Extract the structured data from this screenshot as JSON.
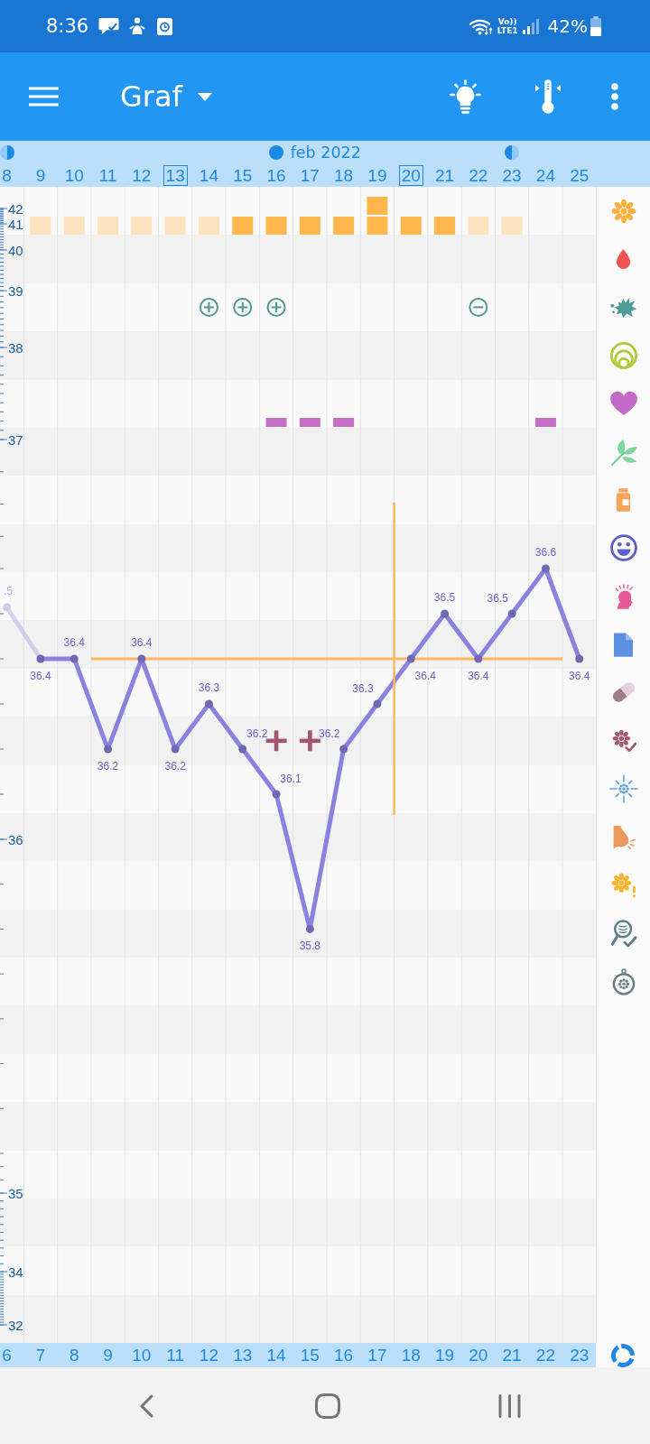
{
  "status_bar": {
    "time": "8:36",
    "volte": "Vo))",
    "network": "LTE1",
    "battery": "42%"
  },
  "app_bar": {
    "title": "Graf"
  },
  "chart": {
    "month": "feb 2022",
    "days": [
      {
        "moon": {
          "kind": "first_quarter"
        },
        "outlined": false,
        "cycle_day": "6"
      },
      {
        "outlined": false,
        "cycle_day": "7",
        "marks": [
          {
            "kind": "low_fertility"
          }
        ]
      },
      {
        "outlined": false,
        "cycle_day": "8",
        "marks": [
          {
            "kind": "low_fertility"
          }
        ]
      },
      {
        "outlined": false,
        "cycle_day": "9",
        "marks": [
          {
            "kind": "low_fertility"
          }
        ]
      },
      {
        "outlined": false,
        "cycle_day": "10",
        "marks": [
          {
            "kind": "low_fertility"
          }
        ]
      },
      {
        "outlined": true,
        "cycle_day": "11",
        "marks": [
          {
            "kind": "low_fertility"
          }
        ]
      },
      {
        "outlined": false,
        "cycle_day": "12",
        "marks": [
          {
            "kind": "low_fertility"
          },
          {
            "kind": "mucus_plus"
          }
        ]
      },
      {
        "outlined": false,
        "cycle_day": "13",
        "marks": [
          {
            "kind": "high_fertility"
          },
          {
            "kind": "mucus_plus"
          }
        ]
      },
      {
        "moon": {
          "kind": "full"
        },
        "outlined": false,
        "cycle_day": "14",
        "marks": [
          {
            "kind": "high_fertility"
          },
          {
            "kind": "mucus_plus"
          },
          {
            "kind": "intercourse"
          },
          {
            "kind": "positive_test"
          }
        ]
      },
      {
        "outlined": false,
        "cycle_day": "15",
        "marks": [
          {
            "kind": "high_fertility"
          },
          {
            "kind": "intercourse"
          },
          {
            "kind": "positive_test"
          }
        ]
      },
      {
        "outlined": false,
        "cycle_day": "16",
        "marks": [
          {
            "kind": "high_fertility"
          },
          {
            "kind": "intercourse"
          }
        ]
      },
      {
        "outlined": false,
        "cycle_day": "17",
        "marks": [
          {
            "kind": "peak_fertility"
          }
        ]
      },
      {
        "outlined": true,
        "cycle_day": "18",
        "marks": [
          {
            "kind": "high_fertility"
          }
        ]
      },
      {
        "outlined": false,
        "cycle_day": "19",
        "marks": [
          {
            "kind": "high_fertility"
          }
        ]
      },
      {
        "outlined": false,
        "cycle_day": "20",
        "marks": [
          {
            "kind": "low_fertility"
          },
          {
            "kind": "mucus_minus"
          }
        ]
      },
      {
        "moon": {
          "kind": "last_quarter"
        },
        "outlined": false,
        "cycle_day": "21",
        "marks": [
          {
            "kind": "low_fertility"
          }
        ]
      },
      {
        "outlined": false,
        "cycle_day": "22",
        "marks": [
          {
            "kind": "intercourse"
          }
        ]
      },
      {
        "outlined": false,
        "cycle_day": "23"
      }
    ],
    "scale_labels": [
      "42",
      "41",
      "40",
      "39",
      "38",
      "37",
      "36",
      "35",
      "34",
      "32"
    ],
    "clipped_label": ".5",
    "chart_data": {
      "type": "line",
      "categories": [
        "8",
        "9",
        "10",
        "11",
        "12",
        "13",
        "14",
        "15",
        "16",
        "17",
        "18",
        "19",
        "20",
        "21",
        "22",
        "23",
        "24",
        "25"
      ],
      "series": [
        {
          "color": "#8b82e0",
          "marker": "circle",
          "values": [
            null,
            36.4,
            36.4,
            36.2,
            36.4,
            36.2,
            36.3,
            36.2,
            36.1,
            35.8,
            36.2,
            36.3,
            36.4,
            36.5,
            36.4,
            36.5,
            36.6,
            36.4
          ]
        }
      ],
      "data_labels": true
    }
  }
}
